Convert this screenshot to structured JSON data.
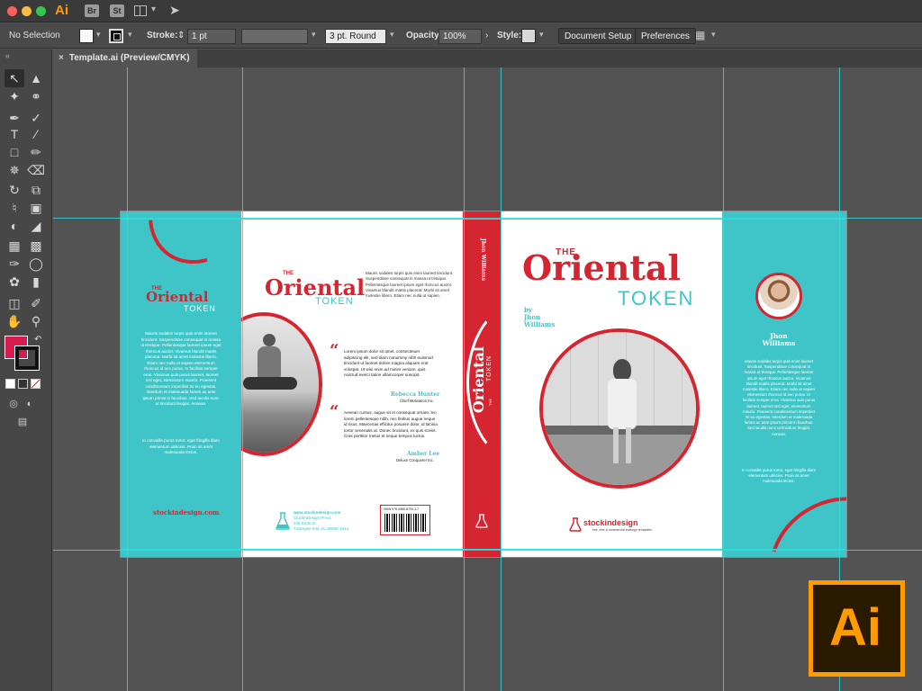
{
  "app": {
    "logo": "Ai",
    "badges": [
      "Br",
      "St"
    ]
  },
  "controlbar": {
    "selection": "No Selection",
    "stroke_label": "Stroke:",
    "stroke_value": "1 pt",
    "brush_value": "3 pt. Round",
    "opacity_label": "Opacity:",
    "opacity_value": "100%",
    "style_label": "Style:",
    "doc_setup": "Document Setup",
    "preferences": "Preferences"
  },
  "document": {
    "tab_title": "Template.ai (Preview/CMYK)",
    "close_glyph": "×"
  },
  "colors": {
    "fill": "#d81b4f",
    "teal": "#3fc5c8",
    "red": "#d42531",
    "guide": "#2fdcdc",
    "ai_orange": "#ff9a00"
  },
  "cover": {
    "the": "THE",
    "title": "Oriental",
    "token": "TOKEN",
    "author_by": "by",
    "author_first": "Jhon",
    "author_last": "Williams",
    "author_spine": "Jhon Williams",
    "left_flap_text": "Mauris sodales turpis quis enim laoreet tincidunt. Suspendisse consequat in massa ut tristique. Pellentesque laoreet ipsum eget rhoncus auctor. Vivamus blandit mattis placerat. Morbi sit amet molestie libero. Etiam nec nulla ut sapien elementum rhoncus id nec purus. In facilisis semper eros. Vivamus quis purus laoreet, laoreet nisl eget, elementum mauris. Praesent condimentum imperdiet mi eu egestas. Interdum et malesuada fames ac ante ipsum primis in faucibus. Sed iaculis nunc ut tincidunt feugiat. Aenean.",
    "left_flap_text2": "In convallis purus tortor, eget fringilla diam elementum ultricies. Proin sit amet malesuada lectus.",
    "left_flap_site": "stockindesign.com",
    "back_blurb": "Mauris sodales turpis quis enim laoreet tincidunt. Suspendisse consequat in massa ut tristique. Pellentesque laoreet ipsum eget rhoncus auctor. Vivamus blandit mattis placerat. Morbi sit amet molestie libero. Etiam nec nulla ut sapien.",
    "quote1_mark": "“",
    "quote1_text": "Lorem ipsum dolor sit amet, consectetuer adipiscing elit, sed diam nonummy nibh euismod tincidunt ut laoreet dolore magna aliquam erat volutpat. Ut wisi enim ad minim veniam, quis nostrud exerci tation ullamcorper suscipit.",
    "quote1_name": "Rebecca Hunter",
    "quote1_role": "Chief Motivation Inc.",
    "quote2_mark": "“",
    "quote2_text": "Aenean cursus, augue sit et consequat ornare, leo lorem pellentesque nibh, nec finibus augue neque id risus. Maecenas efficitur posuere dolor, id lacinia tortor venenatis at. Donec tincidunt, ex quis scelet. Cras porttitor metus et neque tempus luctus.",
    "quote2_name": "Amber Lee",
    "quote2_role": "Deluxe Conquerer Inc.",
    "pub_lines": [
      "www.stockindesign.com",
      "StockInDesign Press",
      "236 Birds St",
      "Tuskegee Inst, AL 36088-1914"
    ],
    "isbn": "ISBN 978-0985-8790-3-7",
    "front_brand": "stockindesign",
    "front_brand_sub": "fine, free & commercial indesign templates",
    "right_flap_bio": "Mauris sodales turpis quis enim laoreet tincidunt. Suspendisse consequat in massa ut tristique. Pellentesque laoreet ipsum eget rhoncus auctor. Vivamus blandit mattis placerat. Morbi sit amet molestie libero. Etiam nec nulla ut sapien elementum rhoncus id nec purus. In facilisis semper eros. Vivamus quis purus laoreet, laoreet nisl eget, elementum mauris. Praesent condimentum imperdiet mi eu egestas. Interdum et malesuada fames ac ante ipsum primis in faucibus. Sed iaculis nunc ut tincidunt feugiat. Aenean.",
    "right_flap_bio2": "In convallis purus tortor, eget fringilla diam elementum ultricies. Proin sit amet malesuada lectus."
  },
  "ai_logo": "Ai",
  "icons": {
    "swap": "↶",
    "expand": "«",
    "caret": "▾",
    "rocket": "🚀",
    "stepper": "⇕",
    "chevron": "›"
  }
}
